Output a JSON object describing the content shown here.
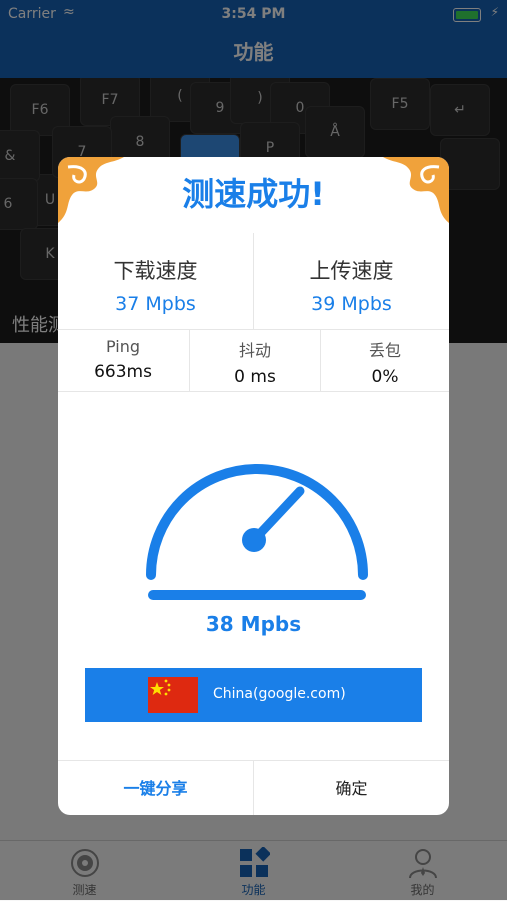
{
  "status_bar": {
    "carrier": "Carrier",
    "time": "3:54 PM"
  },
  "nav": {
    "title": "功能"
  },
  "hero": {
    "caption": "性能测",
    "keys": [
      "F6",
      "F7",
      "(",
      "9",
      ")",
      "0",
      "8",
      "P",
      "Å",
      "U",
      "7",
      "&",
      "6",
      "F5",
      "K"
    ]
  },
  "modal": {
    "title": "测速成功!",
    "download": {
      "label": "下载速度",
      "value": "37 Mpbs"
    },
    "upload": {
      "label": "上传速度",
      "value": "39 Mpbs"
    },
    "stats": [
      {
        "label": "Ping",
        "value": "663ms"
      },
      {
        "label": "抖动",
        "value": "0 ms"
      },
      {
        "label": "丢包",
        "value": "0%"
      }
    ],
    "gauge_value": "38 Mpbs",
    "server": "China(google.com)",
    "share_button": "一键分享",
    "confirm_button": "确定"
  },
  "tabs": [
    {
      "label": "测速",
      "icon": "speedometer-icon"
    },
    {
      "label": "功能",
      "icon": "grid-icon"
    },
    {
      "label": "我的",
      "icon": "user-icon"
    }
  ],
  "colors": {
    "primary": "#1763b7",
    "accent": "#1a7fe8",
    "corner": "#f0a23b"
  }
}
